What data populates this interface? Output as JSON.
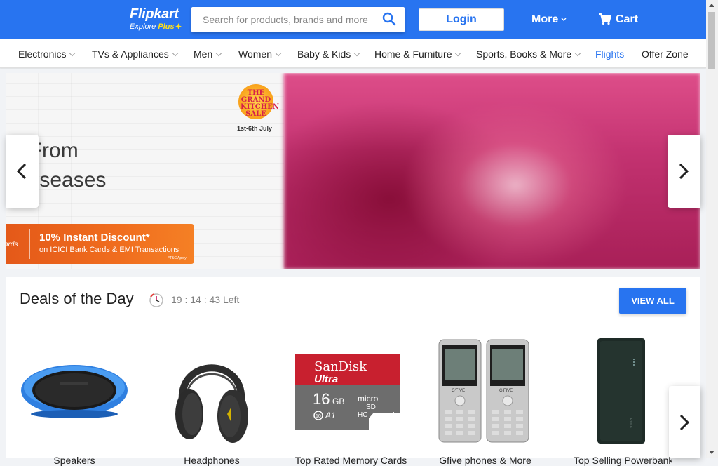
{
  "header": {
    "logo_text": "Flipkart",
    "logo_sub": "Explore",
    "logo_plus": "Plus",
    "search_placeholder": "Search for products, brands and more",
    "login_label": "Login",
    "more_label": "More",
    "cart_label": "Cart",
    "brand_color": "#2874f0"
  },
  "categories": [
    {
      "label": "Electronics",
      "has_dropdown": true
    },
    {
      "label": "TVs & Appliances",
      "has_dropdown": true
    },
    {
      "label": "Men",
      "has_dropdown": true
    },
    {
      "label": "Women",
      "has_dropdown": true
    },
    {
      "label": "Baby & Kids",
      "has_dropdown": true
    },
    {
      "label": "Home & Furniture",
      "has_dropdown": true
    },
    {
      "label": "Sports, Books & More",
      "has_dropdown": true
    },
    {
      "label": "Flights",
      "has_dropdown": false,
      "active": true
    },
    {
      "label": "Offer Zone",
      "has_dropdown": false
    }
  ],
  "banner": {
    "heading_line1": "on From",
    "heading_line2": "ic Diseases",
    "sale_badge": "THE GRAND KITCHEN SALE",
    "sale_dates": "1st-6th July",
    "offer_card_text": "ards",
    "offer_main": "10% Instant Discount*",
    "offer_sub": "on ICICI Bank Cards & EMI Transactions",
    "offer_tc": "*T&C Apply"
  },
  "deals": {
    "title": "Deals of the Day",
    "timer": "19 : 14 : 43 Left",
    "view_all_label": "VIEW ALL",
    "items": [
      {
        "name": "Speakers",
        "icon": "speaker-image"
      },
      {
        "name": "Headphones",
        "icon": "headphones-image"
      },
      {
        "name": "Top Rated Memory Cards",
        "icon": "memory-card-image",
        "brand": "SanDisk",
        "line": "Ultra",
        "capacity": "16",
        "capacity_unit": "GB",
        "format": "micro",
        "format_type": "SD",
        "format_class": "HC",
        "class_mark": "I",
        "speed_10": "10",
        "speed_a1": "A1"
      },
      {
        "name": "Gfive phones & More",
        "icon": "phone-image",
        "brand": "G'FIVE"
      },
      {
        "name": "Top Selling Powerbanks",
        "icon": "powerbank-image",
        "brand": "ROCK"
      }
    ]
  }
}
